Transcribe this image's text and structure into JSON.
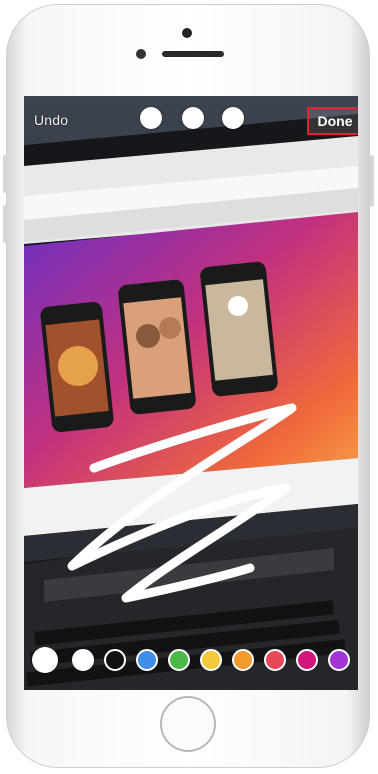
{
  "toolbar": {
    "undo_label": "Undo",
    "done_label": "Done",
    "tools": [
      {
        "name": "marker-pen-icon"
      },
      {
        "name": "brush-tool-icon"
      },
      {
        "name": "neon-pen-icon"
      }
    ]
  },
  "palette": {
    "colors": [
      "#ffffff",
      "#111111",
      "#3f8ee8",
      "#4db84a",
      "#f5c93a",
      "#f39a2c",
      "#e8485a",
      "#d3157c",
      "#a335d6"
    ]
  },
  "accent": {
    "highlight": "#e2232f"
  }
}
